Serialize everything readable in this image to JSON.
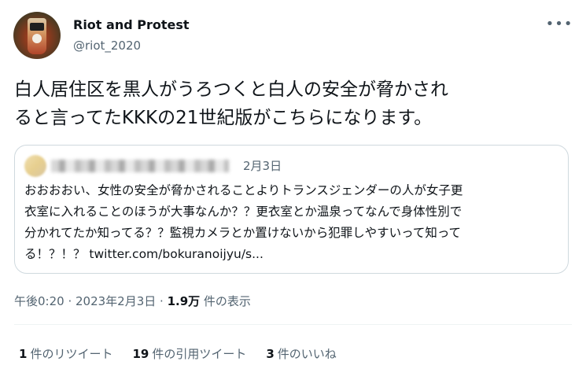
{
  "tweet": {
    "author_name": "Riot and Protest",
    "author_handle": "@riot_2020",
    "text_line1": "白人居住区を黒人がうろつくと白人の安全が脅かされ",
    "text_line2": "ると言ってたKKKの21世紀版がこちらになります。",
    "more_icon": "more-horizontal-icon",
    "timestamp": "午後0:20 · 2023年2月3日",
    "views_separator": " · ",
    "views_count": "1.9万",
    "views_label": " 件の表示"
  },
  "quote": {
    "date": "2月3日",
    "text_line1": "おおおおい、女性の安全が脅かされることよりトランスジェンダーの人が女子更",
    "text_line2": "衣室に入れることのほうが大事なんか？？更衣室とか温泉ってなんで身体性別で",
    "text_line3": "分かれてたか知ってる？？監視カメラとか置けないから犯罪しやすいって知って",
    "text_line4": "る！？！？ twitter.com/bokuranoijyu/s..."
  },
  "stats": {
    "retweets_count": "1",
    "retweets_label": "件のリツイート",
    "quotes_count": "19",
    "quotes_label": "件の引用ツイート",
    "likes_count": "3",
    "likes_label": "件のいいね"
  }
}
